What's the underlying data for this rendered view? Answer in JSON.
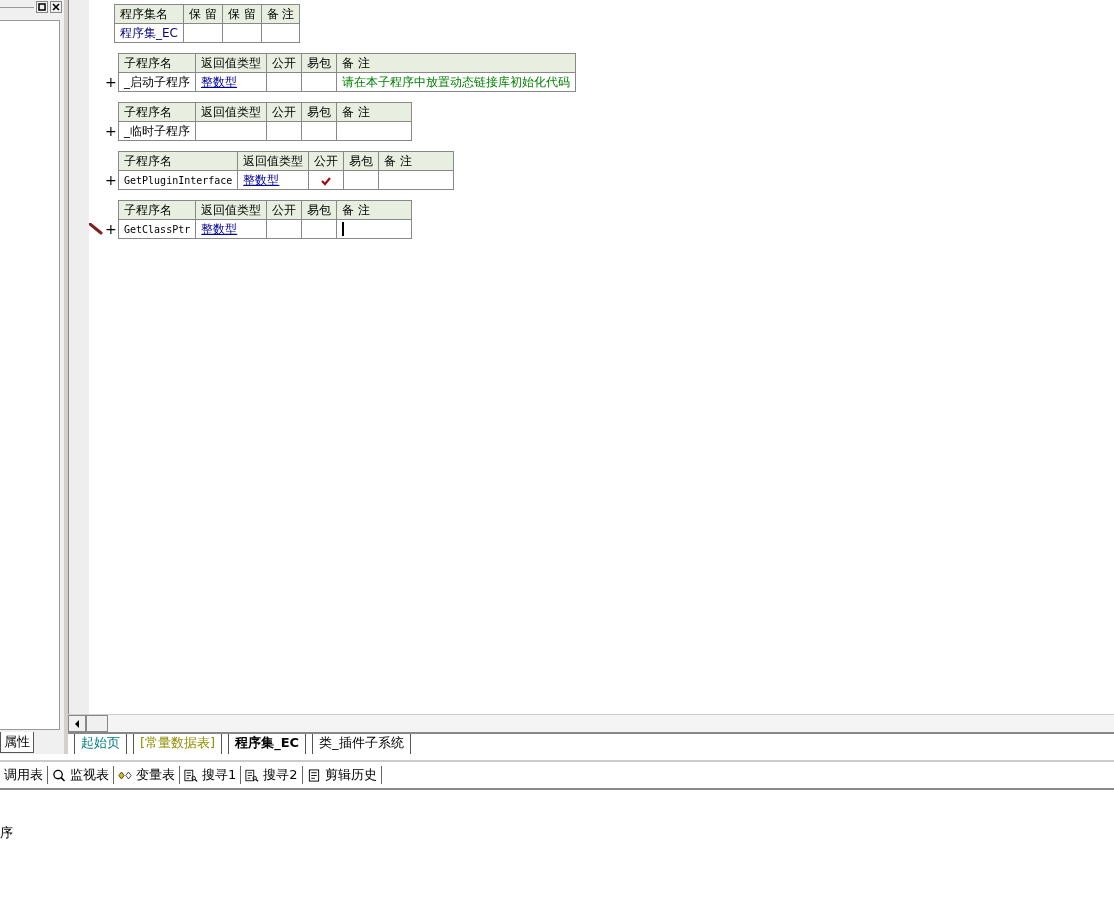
{
  "left_panel": {
    "tab": "属性"
  },
  "assembly_table": {
    "headers": [
      "程序集名",
      "保 留",
      "保 留",
      "备 注"
    ],
    "name": "程序集_EC"
  },
  "subroutines": [
    {
      "headers": [
        "子程序名",
        "返回值类型",
        "公开",
        "易包",
        "备 注"
      ],
      "expander": "+",
      "name": "_启动子程序",
      "return_type": "整数型",
      "public": false,
      "remark": "请在本子程序中放置动态链接库初始化代码",
      "editing": false
    },
    {
      "headers": [
        "子程序名",
        "返回值类型",
        "公开",
        "易包",
        "备 注"
      ],
      "expander": "+",
      "name": "_临时子程序",
      "public": false,
      "editing": false
    },
    {
      "headers": [
        "子程序名",
        "返回值类型",
        "公开",
        "易包",
        "备 注"
      ],
      "expander": "+",
      "name": "GetPluginInterface",
      "return_type": "整数型",
      "public": true,
      "editing": false
    },
    {
      "headers": [
        "子程序名",
        "返回值类型",
        "公开",
        "易包",
        "备 注"
      ],
      "expander": "+",
      "name": "GetClassPtr",
      "return_type": "整数型",
      "public": false,
      "editing": true
    }
  ],
  "editor_tabs": [
    {
      "label": "起始页",
      "kind": "start",
      "selected": false
    },
    {
      "label": "[常量数据表]",
      "kind": "data",
      "selected": false
    },
    {
      "label": "程序集_EC",
      "kind": "module",
      "selected": true
    },
    {
      "label": "类_插件子系统",
      "kind": "module",
      "selected": false
    }
  ],
  "toolbar": [
    {
      "label": "调用表",
      "kind": "plain"
    },
    {
      "label": "监视表",
      "kind": "watch"
    },
    {
      "label": "变量表",
      "kind": "variables"
    },
    {
      "label": "搜寻1",
      "kind": "find"
    },
    {
      "label": "搜寻2",
      "kind": "find"
    },
    {
      "label": "剪辑历史",
      "kind": "clipboard"
    }
  ],
  "output": {
    "text": "序"
  }
}
